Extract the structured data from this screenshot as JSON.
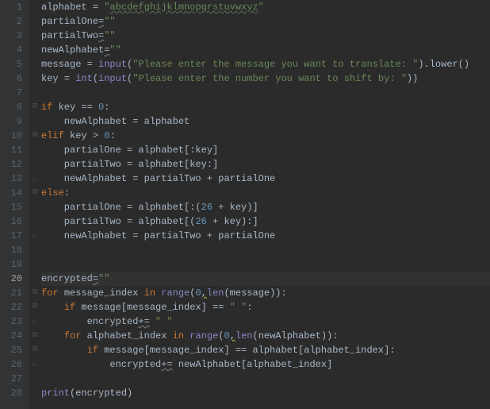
{
  "editor": {
    "current_line": 20,
    "lines": {
      "1": {
        "gutter": "1",
        "fold": ""
      },
      "2": {
        "gutter": "2",
        "fold": ""
      },
      "3": {
        "gutter": "3",
        "fold": ""
      },
      "4": {
        "gutter": "4",
        "fold": ""
      },
      "5": {
        "gutter": "5",
        "fold": ""
      },
      "6": {
        "gutter": "6",
        "fold": ""
      },
      "7": {
        "gutter": "7",
        "fold": ""
      },
      "8": {
        "gutter": "8",
        "fold": "⊟"
      },
      "9": {
        "gutter": "9",
        "fold": ""
      },
      "10": {
        "gutter": "10",
        "fold": "⊟"
      },
      "11": {
        "gutter": "11",
        "fold": ""
      },
      "12": {
        "gutter": "12",
        "fold": ""
      },
      "13": {
        "gutter": "13",
        "fold": "⌞"
      },
      "14": {
        "gutter": "14",
        "fold": "⊟"
      },
      "15": {
        "gutter": "15",
        "fold": ""
      },
      "16": {
        "gutter": "16",
        "fold": ""
      },
      "17": {
        "gutter": "17",
        "fold": "⌞"
      },
      "18": {
        "gutter": "18",
        "fold": ""
      },
      "19": {
        "gutter": "19",
        "fold": ""
      },
      "20": {
        "gutter": "20",
        "fold": ""
      },
      "21": {
        "gutter": "21",
        "fold": "⊟"
      },
      "22": {
        "gutter": "22",
        "fold": "⊟"
      },
      "23": {
        "gutter": "23",
        "fold": "⌞"
      },
      "24": {
        "gutter": "24",
        "fold": "⊟"
      },
      "25": {
        "gutter": "25",
        "fold": "⊟"
      },
      "26": {
        "gutter": "26",
        "fold": "⌞"
      },
      "27": {
        "gutter": "27",
        "fold": ""
      },
      "28": {
        "gutter": "28",
        "fold": ""
      }
    },
    "tokens": {
      "l1_var": "alphabet",
      "l1_eq": " = ",
      "l1_q": "\"",
      "l1_str": "abcdefghijklmnopqrstuvwxyz",
      "l2_var": "partialOne",
      "l2_eq": "=",
      "l2_str": "\"\"",
      "l3_var": "partialTwo",
      "l3_eq": "=",
      "l3_str": "\"\"",
      "l4_var": "newAlphabet",
      "l4_eq": "=",
      "l4_str": "\"\"",
      "l5_var": "message",
      "l5_eq": " = ",
      "l5_fn": "input",
      "l5_p1": "(",
      "l5_str": "\"Please enter the message you want to translate: \"",
      "l5_p2": ").lower()",
      "l6_var": "key",
      "l6_eq": " = ",
      "l6_fn1": "int",
      "l6_p1": "(",
      "l6_fn2": "input",
      "l6_p2": "(",
      "l6_str": "\"Please enter the number you want to shift by: \"",
      "l6_p3": "))",
      "l8_if": "if ",
      "l8_rest": "key == ",
      "l8_num": "0",
      "l8_colon": ":",
      "l9": "    newAlphabet = alphabet",
      "l10_elif": "elif ",
      "l10_rest": "key > ",
      "l10_num": "0",
      "l10_colon": ":",
      "l11": "    partialOne = alphabet[:key]",
      "l12": "    partialTwo = alphabet[key:]",
      "l13": "    newAlphabet = partialTwo + partialOne",
      "l14_else": "else",
      "l14_colon": ":",
      "l15_a": "    partialOne = alphabet[:(",
      "l15_num": "26",
      "l15_b": " + key)]",
      "l16_a": "    partialTwo = alphabet[(",
      "l16_num": "26",
      "l16_b": " + key):]",
      "l17": "    newAlphabet = partialTwo + partialOne",
      "l20_var": "encrypted",
      "l20_eq": "=",
      "l20_str": "\"\"",
      "l21_for": "for ",
      "l21_a": "message_index ",
      "l21_in": "in ",
      "l21_fn": "range",
      "l21_p1": "(",
      "l21_n1": "0",
      "l21_c": ",",
      "l21_fn2": "len",
      "l21_p2": "(message)):",
      "l22_if": "if ",
      "l22_a": "message[message_index] == ",
      "l22_str": "\" \"",
      "l22_colon": ":",
      "l23_a": "encrypted",
      "l23_b": "+=",
      "l23_sp": " ",
      "l23_str": "\" \"",
      "l24_for": "for ",
      "l24_a": "alphabet_index ",
      "l24_in": "in ",
      "l24_fn": "range",
      "l24_p1": "(",
      "l24_n1": "0",
      "l24_c": ",",
      "l24_fn2": "len",
      "l24_p2": "(newAlphabet)):",
      "l25_if": "if ",
      "l25_rest": "message[message_index] == alphabet[alphabet_index]:",
      "l26_a": "encrypted",
      "l26_b": "+=",
      "l26_sp": " ",
      "l26_rest": "newAlphabet[alphabet_index]",
      "l28_fn": "print",
      "l28_p": "(encrypted)"
    }
  }
}
